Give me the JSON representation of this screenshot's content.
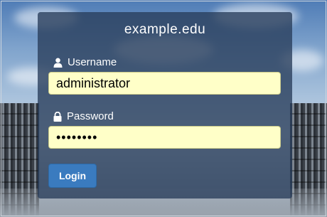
{
  "site": {
    "title": "example.edu"
  },
  "form": {
    "username_label": "Username",
    "username_value": "administrator",
    "password_label": "Password",
    "password_value": "••••••••",
    "login_label": "Login"
  },
  "icons": {
    "user": "user-icon",
    "lock": "lock-icon"
  }
}
